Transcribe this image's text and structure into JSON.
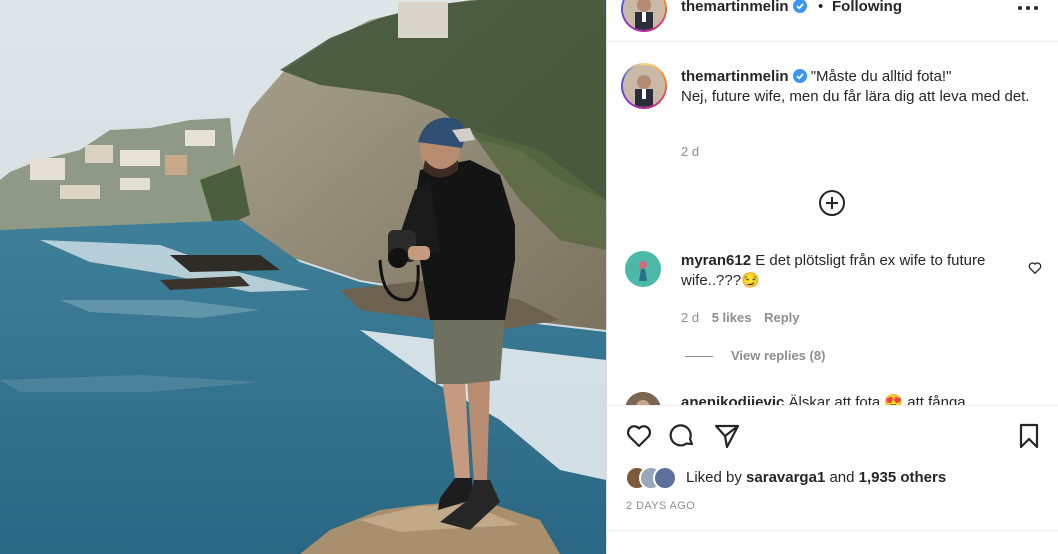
{
  "post": {
    "username": "themartinmelin",
    "follow_status": "Following",
    "separator": "•",
    "verified": true
  },
  "caption": {
    "username": "themartinmelin",
    "text_line1": "\"Måste du alltid fota!\"",
    "text_rest": "Nej, future wife, men du får lära dig att leva med det.",
    "time": "2 d"
  },
  "comments": [
    {
      "username": "myran612",
      "text": "E det plötsligt från ex wife to future wife..???😏",
      "time": "2 d",
      "likes": "5 likes",
      "reply_label": "Reply",
      "view_replies": "View replies (8)"
    },
    {
      "username": "anenikodijevic",
      "text": "Älskar att fota 😍 att fånga"
    }
  ],
  "likes": {
    "prefix": "Liked by ",
    "user": "saravarga1",
    "middle": " and ",
    "others": "1,935 others"
  },
  "post_time": "2 DAYS AGO",
  "icons": [
    "more-icon",
    "verified-icon",
    "add-circle-icon",
    "heart-icon",
    "comment-icon",
    "share-icon",
    "bookmark-icon"
  ],
  "colors": {
    "verified": "#3897f0",
    "text": "#262626",
    "secondary": "#8e8e8e",
    "border": "#dbdbdb"
  }
}
